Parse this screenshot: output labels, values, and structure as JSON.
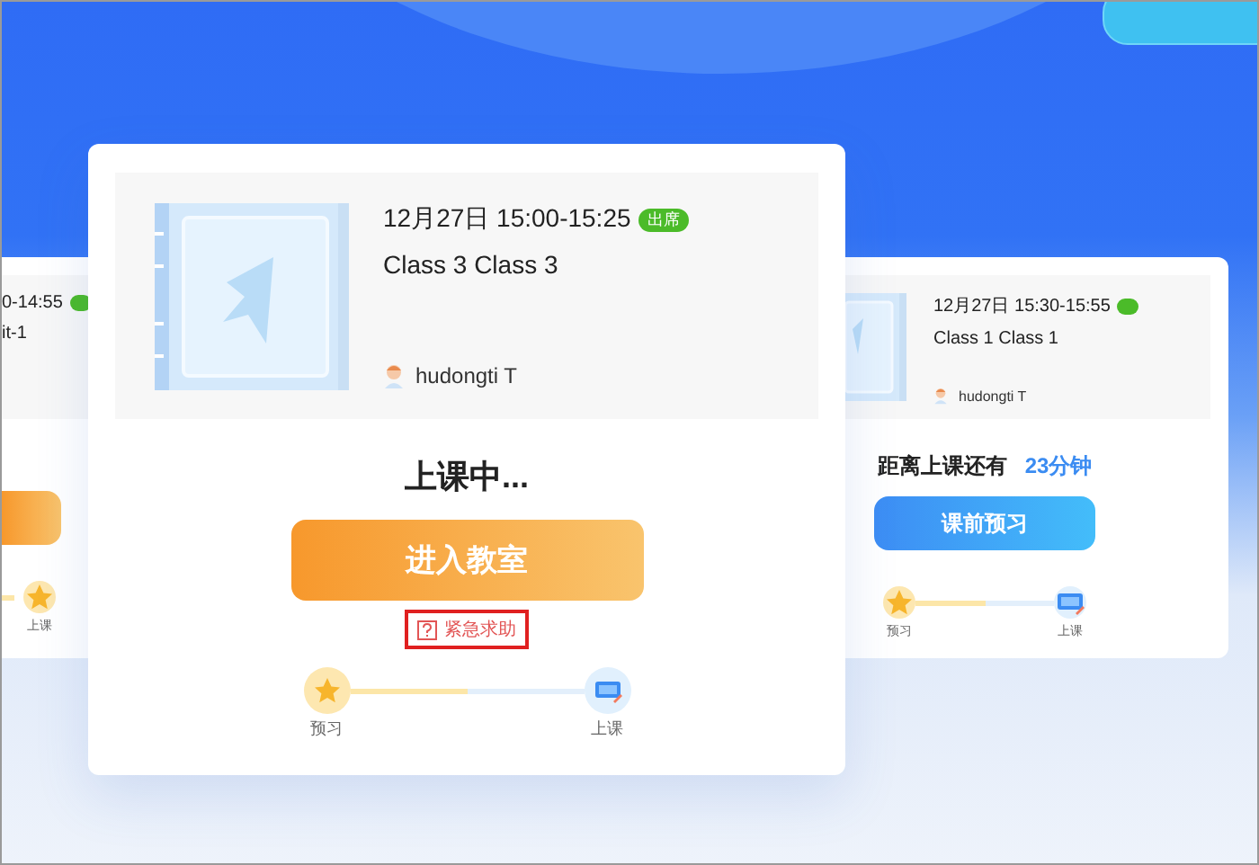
{
  "cards": [
    {
      "kind": "left",
      "date": "0-14:55",
      "badge": true,
      "title": "it-1",
      "action": {
        "kind": "enter"
      },
      "stepper": {
        "end": {
          "kind": "star",
          "label": "上课"
        }
      }
    },
    {
      "kind": "center",
      "date": "12月27日 15:00-15:25",
      "badge": "出席",
      "title": "Class 3 Class 3",
      "teacher": "hudongti T",
      "status": "上课中...",
      "action": {
        "kind": "enter",
        "label": "进入教室"
      },
      "help_link": "紧急求助",
      "stepper": {
        "level": 0.5,
        "start": {
          "kind": "star",
          "label": "预习"
        },
        "end": {
          "kind": "screen",
          "label": "上课"
        }
      }
    },
    {
      "kind": "right",
      "date": "12月27日 15:30-15:55",
      "badge": true,
      "title": "Class 1 Class 1",
      "teacher": "hudongti T",
      "status": "距离上课还有",
      "countdown": "23分钟",
      "action": {
        "kind": "preview",
        "label": "课前预习"
      },
      "stepper": {
        "level": 0.5,
        "start": {
          "kind": "star",
          "label": "预习"
        },
        "end": {
          "kind": "screen",
          "label": "上课"
        }
      }
    }
  ]
}
